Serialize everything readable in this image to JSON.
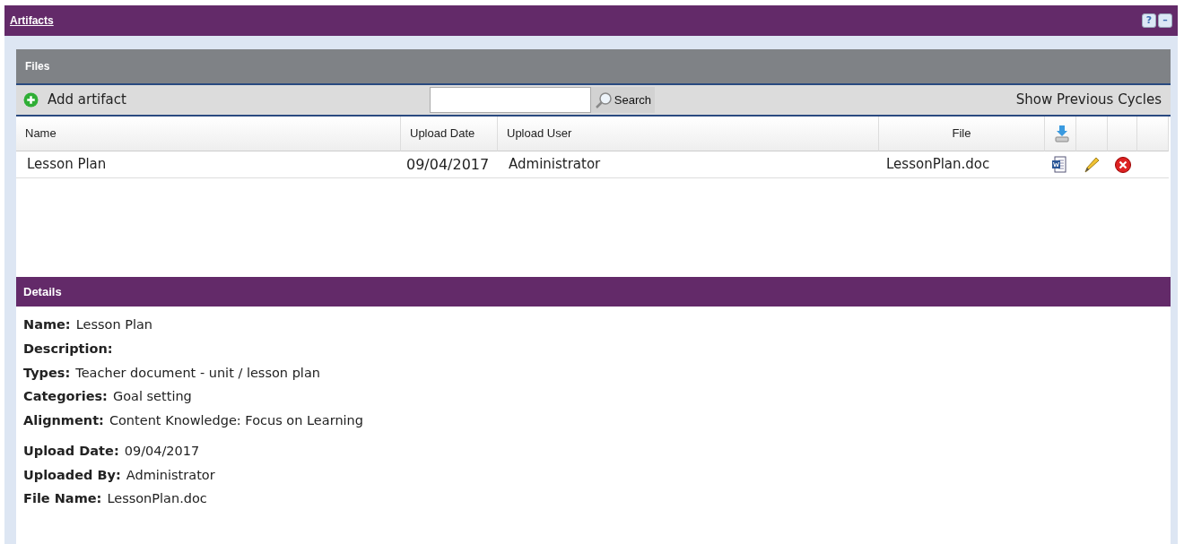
{
  "panel": {
    "title": "Artifacts",
    "buttons": [
      "?",
      "–"
    ]
  },
  "files": {
    "title": "Files",
    "add_label": "Add artifact",
    "search": {
      "button": "Search"
    },
    "previous_cycles": "Show Previous Cycles",
    "columns": [
      "Name",
      "Upload Date",
      "Upload User",
      "File"
    ],
    "rows": [
      {
        "name": "Lesson Plan",
        "upload_date": "09/04/2017",
        "upload_user": "Administrator",
        "file": "LessonPlan.doc"
      }
    ]
  },
  "details": {
    "title": "Details",
    "groups": [
      [
        {
          "label": "Name:",
          "value": "Lesson Plan"
        },
        {
          "label": "Description:"
        },
        {
          "label": "Types:",
          "value": "Teacher document - unit / lesson plan"
        },
        {
          "label": "Categories:",
          "value": "Goal setting"
        },
        {
          "label": "Alignment:",
          "value": "Content Knowledge: Focus on Learning"
        }
      ],
      [
        {
          "label": "Upload Date:",
          "value": "09/04/2017"
        },
        {
          "label": "Uploaded By:",
          "value": "Administrator"
        },
        {
          "label": "File Name:",
          "value": "LessonPlan.doc"
        }
      ]
    ]
  }
}
